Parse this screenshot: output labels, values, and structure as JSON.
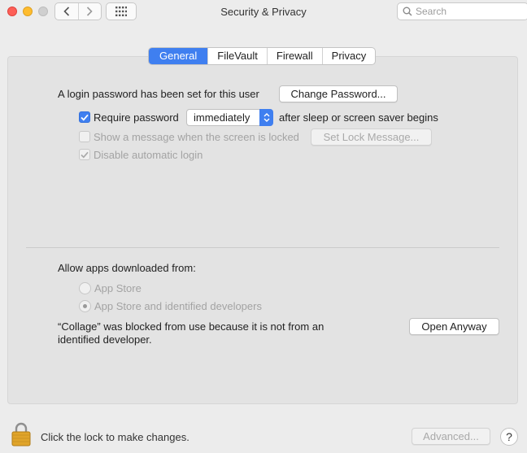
{
  "window": {
    "title": "Security & Privacy"
  },
  "toolbar": {
    "search_placeholder": "Search"
  },
  "tabs": [
    {
      "label": "General",
      "active": true
    },
    {
      "label": "FileVault",
      "active": false
    },
    {
      "label": "Firewall",
      "active": false
    },
    {
      "label": "Privacy",
      "active": false
    }
  ],
  "general": {
    "login_text": "A login password has been set for this user",
    "change_password_label": "Change Password...",
    "require_password_label": "Require password",
    "require_password_checked": true,
    "require_password_delay": "immediately",
    "after_sleep_text": "after sleep or screen saver begins",
    "show_message_label": "Show a message when the screen is locked",
    "show_message_checked": false,
    "set_lock_message_label": "Set Lock Message...",
    "disable_auto_login_label": "Disable automatic login",
    "disable_auto_login_checked": true
  },
  "apps": {
    "heading": "Allow apps downloaded from:",
    "options": [
      {
        "label": "App Store",
        "selected": false
      },
      {
        "label": "App Store and identified developers",
        "selected": true
      }
    ],
    "blocked_line1": "“Collage” was blocked from use because it is not from an",
    "blocked_line2": "identified developer.",
    "open_anyway_label": "Open Anyway"
  },
  "footer": {
    "lock_text": "Click the lock to make changes.",
    "advanced_label": "Advanced...",
    "help_label": "?"
  },
  "icons": {
    "back": "chevron-left-icon",
    "forward": "chevron-right-icon",
    "grid": "grid-icon",
    "search": "search-icon",
    "lock": "lock-icon",
    "check": "checkmark-icon"
  },
  "colors": {
    "accent": "#3f7ff0",
    "close": "#fd5f57",
    "minimize": "#febc2e",
    "zoom_disabled": "#cfcfcf",
    "lock_body": "#e0a42a"
  }
}
